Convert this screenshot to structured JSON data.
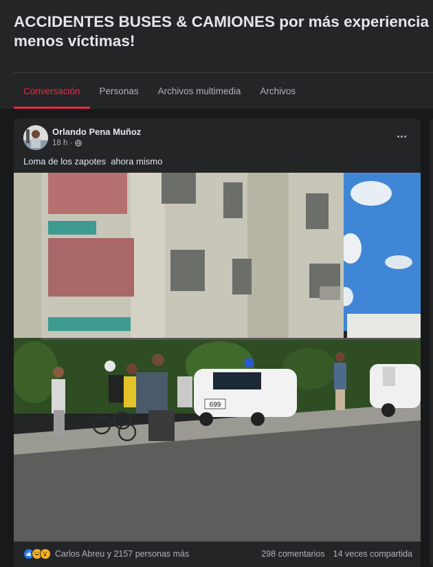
{
  "group": {
    "title": "ACCIDENTES BUSES & CAMIONES por más experiencia menos víctimas!"
  },
  "tabs": [
    {
      "label": "Conversación",
      "active": true
    },
    {
      "label": "Personas",
      "active": false
    },
    {
      "label": "Archivos multimedia",
      "active": false
    },
    {
      "label": "Archivos",
      "active": false
    }
  ],
  "post": {
    "author": "Orlando Pena Muñoz",
    "time": "18 h ·",
    "text": "Loma de los zapotes  ahora mismo",
    "photo_overlay": {
      "plate_number": "699"
    },
    "reactions": {
      "icons": [
        "like-icon",
        "haha-icon",
        "wow-icon"
      ],
      "summary": "Carlos Abreu y 2157 personas más"
    },
    "comments": "298 comentarios",
    "shares": "14 veces compartida"
  },
  "colors": {
    "background": "#18191a",
    "card": "#242526",
    "accent": "#f02849",
    "text": "#e4e6eb",
    "muted": "#b0b3b8",
    "like": "#2078f4"
  }
}
